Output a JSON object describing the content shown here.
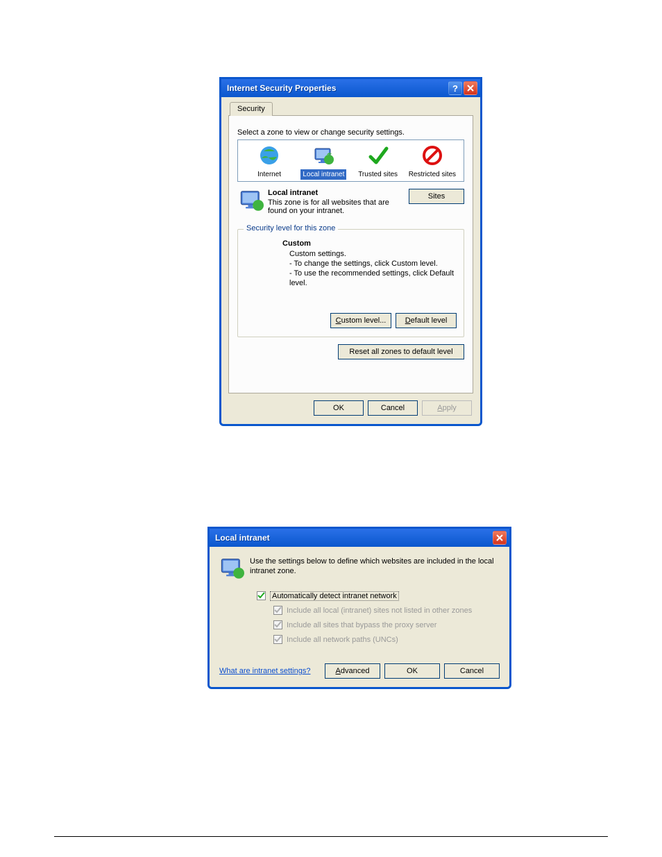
{
  "dialog1": {
    "title": "Internet Security Properties",
    "tab": "Security",
    "zone_prompt": "Select a zone to view or change security settings.",
    "zones": [
      {
        "label": "Internet"
      },
      {
        "label": "Local intranet",
        "selected": true
      },
      {
        "label": "Trusted sites"
      },
      {
        "label": "Restricted sites"
      }
    ],
    "selected_zone": {
      "name": "Local intranet",
      "desc": "This zone is for all websites that are found on your intranet."
    },
    "sites_button": "Sites",
    "group_legend": "Security level for this zone",
    "custom": {
      "title": "Custom",
      "line1": "Custom settings.",
      "line2": "- To change the settings, click Custom level.",
      "line3": "- To use the recommended settings, click Default level."
    },
    "buttons": {
      "custom_level": "Custom level...",
      "default_level": "Default level",
      "reset": "Reset all zones to default level",
      "ok": "OK",
      "cancel": "Cancel",
      "apply": "Apply"
    }
  },
  "dialog2": {
    "title": "Local intranet",
    "intro": "Use the settings below to define which websites are included in the local intranet zone.",
    "checkboxes": {
      "auto": {
        "label": "Automatically detect intranet network",
        "checked": true,
        "enabled": true
      },
      "local": {
        "label": "Include all local (intranet) sites not listed in other zones",
        "checked": true,
        "enabled": false
      },
      "proxy": {
        "label": "Include all sites that bypass the proxy server",
        "checked": true,
        "enabled": false
      },
      "unc": {
        "label": "Include all network paths (UNCs)",
        "checked": true,
        "enabled": false
      }
    },
    "link": "What are intranet settings?",
    "buttons": {
      "advanced": "Advanced",
      "ok": "OK",
      "cancel": "Cancel"
    }
  }
}
